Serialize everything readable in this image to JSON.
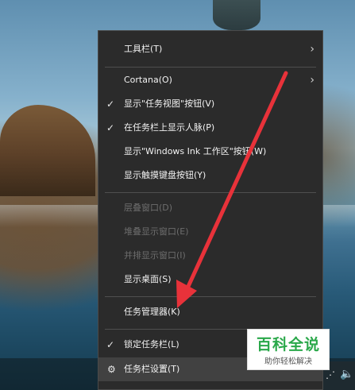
{
  "context_menu": {
    "items": [
      {
        "label": "工具栏(T)",
        "checked": false,
        "submenu": true,
        "disabled": false
      },
      {
        "label": "Cortana(O)",
        "checked": false,
        "submenu": true,
        "disabled": false
      },
      {
        "label": "显示\"任务视图\"按钮(V)",
        "checked": true,
        "submenu": false,
        "disabled": false
      },
      {
        "label": "在任务栏上显示人脉(P)",
        "checked": true,
        "submenu": false,
        "disabled": false
      },
      {
        "label": "显示\"Windows Ink 工作区\"按钮(W)",
        "checked": false,
        "submenu": false,
        "disabled": false
      },
      {
        "label": "显示触摸键盘按钮(Y)",
        "checked": false,
        "submenu": false,
        "disabled": false
      },
      {
        "label": "层叠窗口(D)",
        "checked": false,
        "submenu": false,
        "disabled": true
      },
      {
        "label": "堆叠显示窗口(E)",
        "checked": false,
        "submenu": false,
        "disabled": true
      },
      {
        "label": "并排显示窗口(I)",
        "checked": false,
        "submenu": false,
        "disabled": true
      },
      {
        "label": "显示桌面(S)",
        "checked": false,
        "submenu": false,
        "disabled": false
      },
      {
        "label": "任务管理器(K)",
        "checked": false,
        "submenu": false,
        "disabled": false
      },
      {
        "label": "锁定任务栏(L)",
        "checked": true,
        "submenu": false,
        "disabled": false
      },
      {
        "label": "任务栏设置(T)",
        "checked": false,
        "submenu": false,
        "disabled": false,
        "icon": "gear-icon"
      }
    ],
    "check_glyph": "✓",
    "chevron_glyph": "›",
    "gear_glyph": "⚙"
  },
  "tray": {
    "network_icon": "wifi-icon",
    "volume_icon": "volume-icon",
    "network_glyph": "⋰",
    "volume_glyph": "🔈"
  },
  "watermark": {
    "title": "百科全说",
    "subtitle": "助你轻松解决"
  },
  "colors": {
    "menu_bg": "#2b2b2b",
    "menu_text": "#f2f2f2",
    "disabled_text": "#6d6d6d",
    "arrow": "#e8323a",
    "watermark_green": "#2aa84a"
  }
}
